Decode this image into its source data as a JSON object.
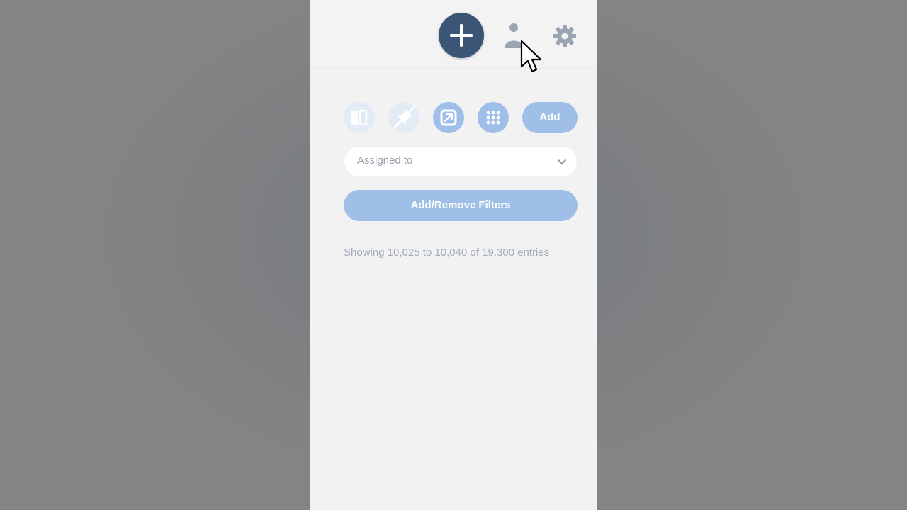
{
  "header": {
    "icons": [
      "plus-icon",
      "user-icon",
      "gear-icon"
    ]
  },
  "toolbar": {
    "icons": [
      "columns-icon",
      "pin-off-icon",
      "expand-icon",
      "grid-icon"
    ],
    "add_label": "Add"
  },
  "filter": {
    "assigned_placeholder": "Assigned to",
    "add_remove_label": "Add/Remove Filters"
  },
  "status": {
    "entries_text": "Showing 10,025 to 10,040 of 19,300 entries"
  },
  "colors": {
    "primary": "#3b5577",
    "accent_light": "#9fbfe9",
    "accent_faint": "#e3ebf6",
    "icon_gray": "#9aa4b2"
  }
}
